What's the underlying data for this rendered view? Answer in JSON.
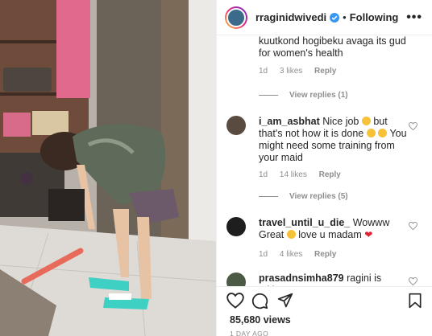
{
  "post": {
    "username": "rraginidwivedi",
    "follow_label": "Following",
    "separator": "•",
    "more_label": "•••"
  },
  "comments": [
    {
      "id": "c0",
      "text_fragment": "kuutkond hogibeku avaga its gud for women's health",
      "age": "1d",
      "likes": "3 likes",
      "reply_label": "Reply",
      "view_replies": "View replies (1)"
    },
    {
      "id": "c1",
      "username": "i_am_asbhat",
      "text_part1": "Nice job",
      "text_part2": "but that's not how it is done",
      "text_part3": "You might need some training from your maid",
      "age": "1d",
      "likes": "14 likes",
      "reply_label": "Reply",
      "view_replies": "View replies (5)"
    },
    {
      "id": "c2",
      "username": "travel_until_u_die_",
      "text_part1": "Wowww Great",
      "text_part2": "love u madam",
      "age": "1d",
      "likes": "4 likes",
      "reply_label": "Reply"
    },
    {
      "id": "c3",
      "username": "prasadnsimha879",
      "text_part1": "ragini is taking"
    }
  ],
  "footer": {
    "views": "85,680 views",
    "date": "1 DAY AGO"
  },
  "icons": {
    "like": "heart-outline-icon",
    "comment": "comment-bubble-icon",
    "share": "paper-plane-icon",
    "save": "bookmark-icon"
  },
  "colors": {
    "verified": "#3897f0",
    "muted": "#8e8e8e",
    "text": "#262626"
  }
}
